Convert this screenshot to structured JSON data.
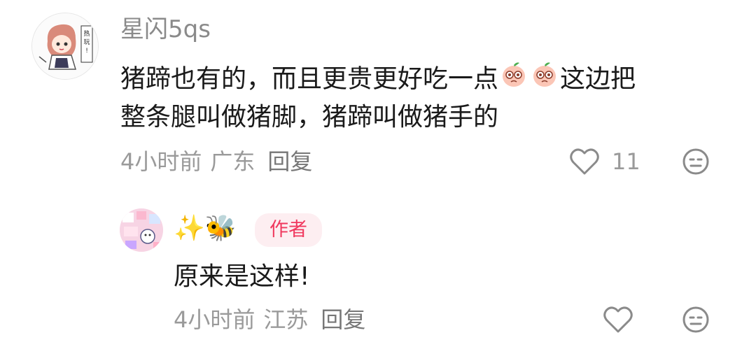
{
  "comments": [
    {
      "username": "星闪5qs",
      "text_line1_a": "猪蹄也有的，而且更贵更好吃一点",
      "text_line1_b": "这边把",
      "text_line2": "整条腿叫做猪脚，猪蹄叫做猪手的",
      "inline_emoji": [
        "peach-face-emoji",
        "peach-face-emoji"
      ],
      "time": "4小时前",
      "location": "广东",
      "reply_label": "回复",
      "like_count": "11",
      "avatar_text": "热玩!"
    },
    {
      "username_emoji": "✨🐝",
      "author_badge": "作者",
      "text": "原来是这样!",
      "time": "4小时前",
      "location": "江苏",
      "reply_label": "回复"
    }
  ],
  "colors": {
    "badge_bg": "#fdeef1",
    "badge_text": "#f0385e",
    "meta_gray": "#9a9a9a"
  }
}
